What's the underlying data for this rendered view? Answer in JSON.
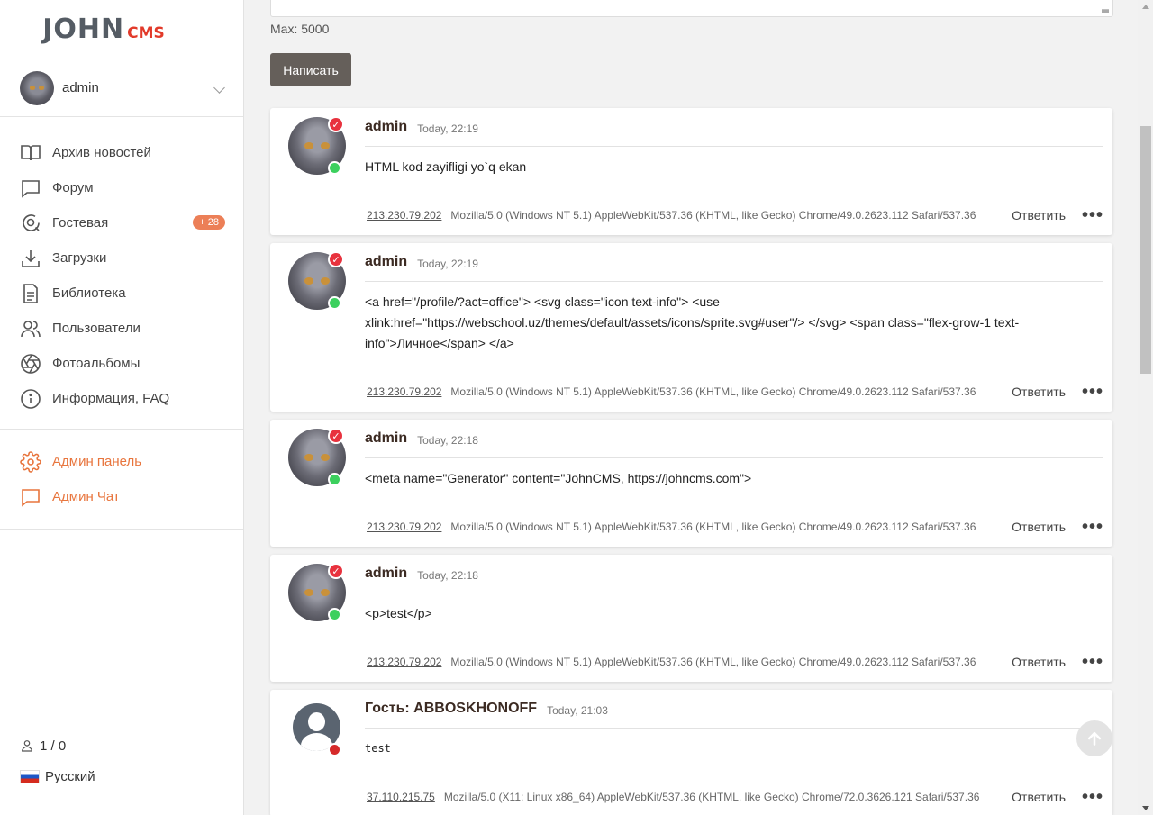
{
  "logo": {
    "main": "JOHN",
    "sub": "CMS"
  },
  "user": {
    "name": "admin"
  },
  "nav": [
    {
      "label": "Архив новостей",
      "icon": "book-open-icon"
    },
    {
      "label": "Форум",
      "icon": "chat-square-icon"
    },
    {
      "label": "Гостевая",
      "icon": "chat-search-icon",
      "badge": "+ 28"
    },
    {
      "label": "Загрузки",
      "icon": "download-icon"
    },
    {
      "label": "Библиотека",
      "icon": "document-icon"
    },
    {
      "label": "Пользователи",
      "icon": "users-icon"
    },
    {
      "label": "Фотоальбомы",
      "icon": "aperture-icon"
    },
    {
      "label": "Информация, FAQ",
      "icon": "info-icon"
    }
  ],
  "admin_nav": [
    {
      "label": "Админ панель",
      "icon": "gear-icon"
    },
    {
      "label": "Админ Чат",
      "icon": "chat-square-icon"
    }
  ],
  "footer": {
    "online": "1 / 0",
    "language": "Русский"
  },
  "colors": {
    "accent": "#e8753d",
    "badge": "#ec7f57",
    "button": "#655f5a",
    "online": "#3cd05e",
    "verified": "#e8323e"
  },
  "form": {
    "max_label": "Max: 5000",
    "submit_label": "Написать"
  },
  "posts": [
    {
      "author": "admin",
      "time": "Today, 22:19",
      "lines": [
        "HTML kod zayifligi yo`q ekan"
      ],
      "ip": "213.230.79.202",
      "ua": "Mozilla/5.0 (Windows NT 5.1) AppleWebKit/537.36 (KHTML, like Gecko) Chrome/49.0.2623.112 Safari/537.36",
      "reply": "Ответить"
    },
    {
      "author": "admin",
      "time": "Today, 22:19",
      "lines": [
        "<a href=\"/profile/?act=office\"> <svg class=\"icon text-info\"> <use",
        "xlink:href=\"https://webschool.uz/themes/default/assets/icons/sprite.svg#user\"/> </svg> <span class=\"flex-grow-1 text-",
        "info\">Личное</span> </a>"
      ],
      "ip": "213.230.79.202",
      "ua": "Mozilla/5.0 (Windows NT 5.1) AppleWebKit/537.36 (KHTML, like Gecko) Chrome/49.0.2623.112 Safari/537.36",
      "reply": "Ответить"
    },
    {
      "author": "admin",
      "time": "Today, 22:18",
      "lines": [
        "<meta name=\"Generator\" content=\"JohnCMS, https://johncms.com\">"
      ],
      "ip": "213.230.79.202",
      "ua": "Mozilla/5.0 (Windows NT 5.1) AppleWebKit/537.36 (KHTML, like Gecko) Chrome/49.0.2623.112 Safari/537.36",
      "reply": "Ответить"
    },
    {
      "author": "admin",
      "time": "Today, 22:18",
      "lines": [
        "<p>test</p>"
      ],
      "ip": "213.230.79.202",
      "ua": "Mozilla/5.0 (Windows NT 5.1) AppleWebKit/537.36 (KHTML, like Gecko) Chrome/49.0.2623.112 Safari/537.36",
      "reply": "Ответить"
    },
    {
      "author": "Гость: ABBOSKHONOFF",
      "time": "Today, 21:03",
      "lines": [
        "test"
      ],
      "ip": "37.110.215.75",
      "ua": "Mozilla/5.0 (X11; Linux x86_64) AppleWebKit/537.36 (KHTML, like Gecko) Chrome/72.0.3626.121 Safari/537.36",
      "reply": "Ответить"
    }
  ]
}
